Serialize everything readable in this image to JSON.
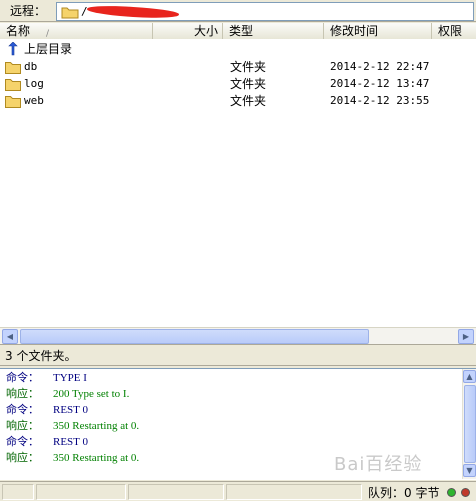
{
  "remote_bar": {
    "label": "远程：",
    "path_prefix": "/"
  },
  "columns": {
    "name": "名称",
    "size": "大小",
    "type": "类型",
    "modified": "修改时间",
    "perm": "权限"
  },
  "parent_dir_label": "上层目录",
  "files": [
    {
      "name": "db",
      "type": "文件夹",
      "modified": "2014-2-12 22:47"
    },
    {
      "name": "log",
      "type": "文件夹",
      "modified": "2014-2-12 13:47"
    },
    {
      "name": "web",
      "type": "文件夹",
      "modified": "2014-2-12 23:55"
    }
  ],
  "list_status": "3 个文件夹。",
  "log": [
    {
      "kind": "cmd",
      "label": "命令：",
      "text": "TYPE I"
    },
    {
      "kind": "resp",
      "label": "响应：",
      "text": "200 Type set to I."
    },
    {
      "kind": "cmd",
      "label": "命令：",
      "text": "REST 0"
    },
    {
      "kind": "resp",
      "label": "响应：",
      "text": "350 Restarting at 0."
    },
    {
      "kind": "cmd",
      "label": "命令：",
      "text": "REST 0"
    },
    {
      "kind": "resp",
      "label": "响应：",
      "text": "350 Restarting at 0."
    }
  ],
  "statusbar": {
    "queue_text": "队列：0 字节"
  },
  "icons": {
    "folder": "folder-icon",
    "parent": "up-arrow-icon"
  },
  "colors": {
    "folder_fill": "#f5d36b",
    "command_text": "#000080",
    "response_text": "#008000",
    "led_green": "#2fb52f",
    "led_red": "#c0392b"
  }
}
